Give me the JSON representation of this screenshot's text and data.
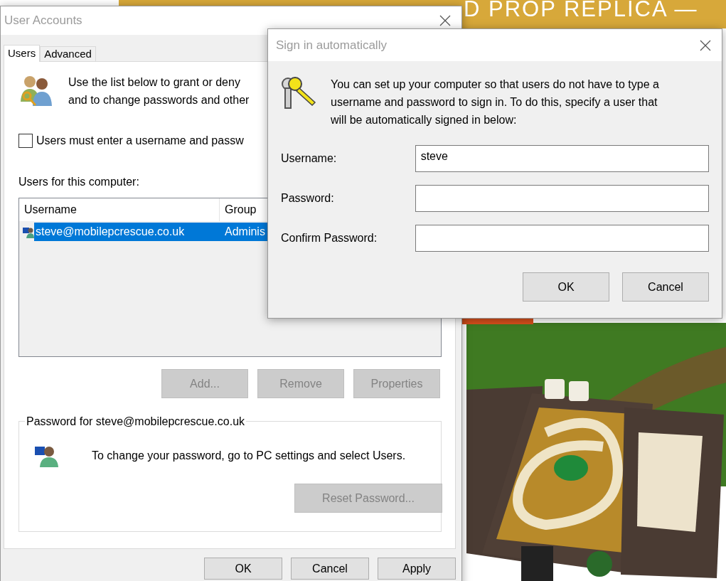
{
  "background_page": {
    "banner": "D PROP REPLICA —"
  },
  "user_accounts": {
    "title": "User Accounts",
    "tabs": [
      {
        "label": "Users",
        "selected": true
      },
      {
        "label": "Advanced",
        "selected": false
      }
    ],
    "intro_lines": [
      "Use the list below to grant or deny",
      "and to change passwords and other"
    ],
    "require_login": {
      "label": "Users must enter a username and passw",
      "checked": false
    },
    "users_label": "Users for this computer:",
    "table": {
      "columns": [
        "Username",
        "Group"
      ],
      "rows": [
        {
          "cells": [
            "steve@mobilepcrescue.co.uk",
            "Adminis"
          ],
          "selected": true
        }
      ]
    },
    "list_buttons": [
      {
        "label": "Add...",
        "disabled": true
      },
      {
        "label": "Remove",
        "disabled": true
      },
      {
        "label": "Properties",
        "disabled": true
      }
    ],
    "password_group": {
      "legend": "Password for steve@mobilepcrescue.co.uk",
      "message": "To change your password, go to PC settings and select Users.",
      "button": {
        "label": "Reset Password...",
        "disabled": true
      }
    },
    "buttons": [
      "OK",
      "Cancel",
      "Apply"
    ]
  },
  "sign_in_dialog": {
    "title": "Sign in automatically",
    "message": "You can set up your computer so that users do not have to type a username and password to sign in. To do this, specify a user that will be automatically signed in below:",
    "fields": [
      {
        "label": "Username:",
        "value": "steve"
      },
      {
        "label": "Password:"
      },
      {
        "label": "Confirm Password:"
      }
    ],
    "buttons": [
      "OK",
      "Cancel"
    ]
  }
}
